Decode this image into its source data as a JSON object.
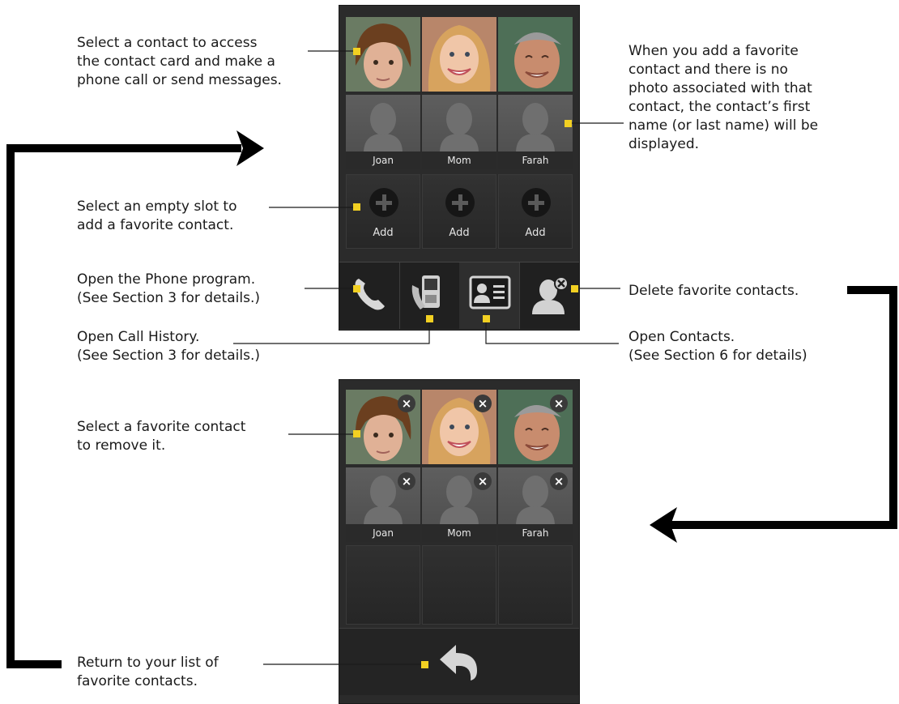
{
  "callouts": {
    "select_contact": [
      "Select a contact to access",
      "the contact card and make a",
      "phone call or send messages."
    ],
    "no_photo": [
      "When you add a favorite",
      "contact and there is no",
      "photo associated with that",
      "contact, the contact’s first",
      "name (or last name) will be",
      "displayed."
    ],
    "empty_slot": [
      "Select an empty slot to",
      "add a favorite contact."
    ],
    "phone_program": [
      "Open the Phone program.",
      "(See Section 3 for details.)"
    ],
    "delete_favorites": [
      "Delete favorite contacts."
    ],
    "call_history": [
      "Open Call History.",
      "(See Section 3 for details.)"
    ],
    "open_contacts": [
      "Open Contacts.",
      "(See Section 6 for details)"
    ],
    "remove_favorite": [
      "Select a favorite contact",
      "to remove it."
    ],
    "return_list": [
      "Return to your list of",
      "favorite contacts."
    ]
  },
  "favorites_screen": {
    "contacts_without_photo": [
      "Joan",
      "Mom",
      "Farah"
    ],
    "add_label": "Add",
    "toolbar_icons": [
      "phone-icon",
      "call-history-icon",
      "contacts-card-icon",
      "delete-contact-icon"
    ]
  },
  "remove_screen": {
    "contacts_without_photo": [
      "Joan",
      "Mom",
      "Farah"
    ],
    "remove_icon": "×"
  },
  "colors": {
    "pointer": "#f2d022",
    "screen_bg": "#2b2b2b",
    "arrow": "#000000"
  }
}
